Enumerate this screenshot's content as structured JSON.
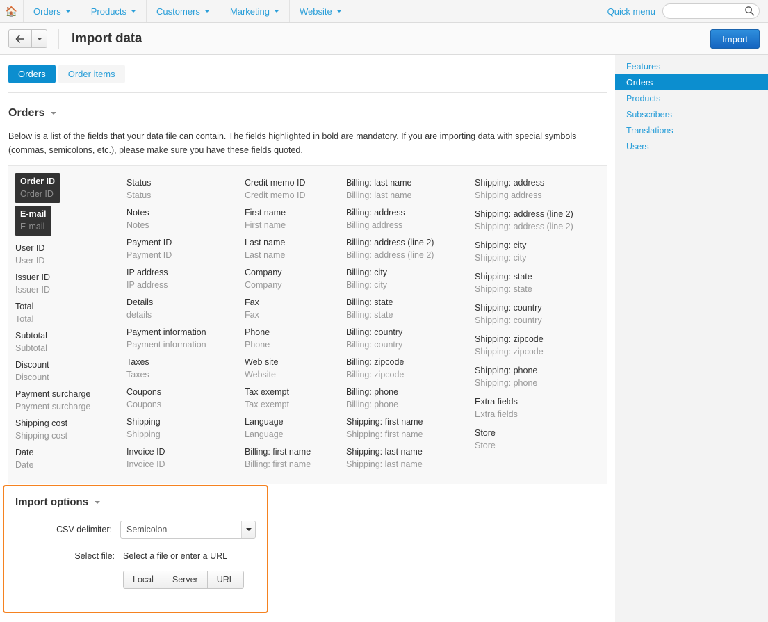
{
  "topnav": {
    "home_icon": "home-icon",
    "items": [
      {
        "label": "Orders",
        "has_caret": true
      },
      {
        "label": "Products",
        "has_caret": true
      },
      {
        "label": "Customers",
        "has_caret": true
      },
      {
        "label": "Marketing",
        "has_caret": true
      },
      {
        "label": "Website",
        "has_caret": true
      }
    ],
    "quick_menu": "Quick menu",
    "search_value": "",
    "search_placeholder": "",
    "search_icon": "search-icon"
  },
  "header": {
    "back_icon": "arrow-left-icon",
    "title": "Import data",
    "import_button": "Import"
  },
  "tabs": [
    {
      "label": "Orders",
      "active": true
    },
    {
      "label": "Order items",
      "active": false
    }
  ],
  "section": {
    "title": "Orders",
    "description": "Below is a list of the fields that your data file can contain. The fields highlighted in bold are mandatory. If you are importing data with special symbols (commas, semicolons, etc.), please make sure you have these fields quoted."
  },
  "fields": {
    "col1": [
      {
        "title": "Order ID",
        "sub": "Order ID",
        "mandatory": true
      },
      {
        "title": "E-mail",
        "sub": "E-mail",
        "mandatory": true
      },
      {
        "title": "User ID",
        "sub": "User ID",
        "mandatory": false
      },
      {
        "title": "Issuer ID",
        "sub": "Issuer ID",
        "mandatory": false
      },
      {
        "title": "Total",
        "sub": "Total",
        "mandatory": false
      },
      {
        "title": "Subtotal",
        "sub": "Subtotal",
        "mandatory": false
      },
      {
        "title": "Discount",
        "sub": "Discount",
        "mandatory": false
      },
      {
        "title": "Payment surcharge",
        "sub": "Payment surcharge",
        "mandatory": false
      },
      {
        "title": "Shipping cost",
        "sub": "Shipping cost",
        "mandatory": false
      },
      {
        "title": "Date",
        "sub": "Date",
        "mandatory": false
      }
    ],
    "col2": [
      {
        "title": "Status",
        "sub": "Status",
        "mandatory": false
      },
      {
        "title": "Notes",
        "sub": "Notes",
        "mandatory": false
      },
      {
        "title": "Payment ID",
        "sub": "Payment ID",
        "mandatory": false
      },
      {
        "title": "IP address",
        "sub": "IP address",
        "mandatory": false
      },
      {
        "title": "Details",
        "sub": "details",
        "mandatory": false
      },
      {
        "title": "Payment information",
        "sub": "Payment information",
        "mandatory": false
      },
      {
        "title": "Taxes",
        "sub": "Taxes",
        "mandatory": false
      },
      {
        "title": "Coupons",
        "sub": "Coupons",
        "mandatory": false
      },
      {
        "title": "Shipping",
        "sub": "Shipping",
        "mandatory": false
      },
      {
        "title": "Invoice ID",
        "sub": "Invoice ID",
        "mandatory": false
      }
    ],
    "col3": [
      {
        "title": "Credit memo ID",
        "sub": "Credit memo ID",
        "mandatory": false
      },
      {
        "title": "First name",
        "sub": "First name",
        "mandatory": false
      },
      {
        "title": "Last name",
        "sub": "Last name",
        "mandatory": false
      },
      {
        "title": "Company",
        "sub": "Company",
        "mandatory": false
      },
      {
        "title": "Fax",
        "sub": "Fax",
        "mandatory": false
      },
      {
        "title": "Phone",
        "sub": "Phone",
        "mandatory": false
      },
      {
        "title": "Web site",
        "sub": "Website",
        "mandatory": false
      },
      {
        "title": "Tax exempt",
        "sub": "Tax exempt",
        "mandatory": false
      },
      {
        "title": "Language",
        "sub": "Language",
        "mandatory": false
      },
      {
        "title": "Billing: first name",
        "sub": "Billing: first name",
        "mandatory": false
      }
    ],
    "col4": [
      {
        "title": "Billing: last name",
        "sub": "Billing: last name",
        "mandatory": false
      },
      {
        "title": "Billing: address",
        "sub": "Billing address",
        "mandatory": false
      },
      {
        "title": "Billing: address (line 2)",
        "sub": "Billing: address (line 2)",
        "mandatory": false
      },
      {
        "title": "Billing: city",
        "sub": "Billing: city",
        "mandatory": false
      },
      {
        "title": "Billing: state",
        "sub": "Billing: state",
        "mandatory": false
      },
      {
        "title": "Billing: country",
        "sub": "Billing: country",
        "mandatory": false
      },
      {
        "title": "Billing: zipcode",
        "sub": "Billing: zipcode",
        "mandatory": false
      },
      {
        "title": "Billing: phone",
        "sub": "Billing: phone",
        "mandatory": false
      },
      {
        "title": "Shipping: first name",
        "sub": "Shipping: first name",
        "mandatory": false
      },
      {
        "title": "Shipping: last name",
        "sub": "Shipping: last name",
        "mandatory": false
      }
    ],
    "col5": [
      {
        "title": "Shipping: address",
        "sub": "Shipping address",
        "mandatory": false
      },
      {
        "title": "Shipping: address (line 2)",
        "sub": "Shipping: address (line 2)",
        "mandatory": false
      },
      {
        "title": "Shipping: city",
        "sub": "Shipping: city",
        "mandatory": false
      },
      {
        "title": "Shipping: state",
        "sub": "Shipping: state",
        "mandatory": false
      },
      {
        "title": "Shipping: country",
        "sub": "Shipping: country",
        "mandatory": false
      },
      {
        "title": "Shipping: zipcode",
        "sub": "Shipping: zipcode",
        "mandatory": false
      },
      {
        "title": "Shipping: phone",
        "sub": "Shipping: phone",
        "mandatory": false
      },
      {
        "title": "Extra fields",
        "sub": "Extra fields",
        "mandatory": false
      },
      {
        "title": "Store",
        "sub": "Store",
        "mandatory": false
      }
    ]
  },
  "import_options": {
    "title": "Import options",
    "csv_delimiter_label": "CSV delimiter:",
    "csv_delimiter_value": "Semicolon",
    "csv_delimiter_options": [
      "Semicolon"
    ],
    "select_file_label": "Select file:",
    "select_file_value": "Select a file or enter a URL",
    "source_buttons": [
      "Local",
      "Server",
      "URL"
    ]
  },
  "sidebar": {
    "items": [
      {
        "label": "Features",
        "active": false
      },
      {
        "label": "Orders",
        "active": true
      },
      {
        "label": "Products",
        "active": false
      },
      {
        "label": "Subscribers",
        "active": false
      },
      {
        "label": "Translations",
        "active": false
      },
      {
        "label": "Users",
        "active": false
      }
    ]
  },
  "colors": {
    "accent_blue": "#0c8ecf",
    "link_blue": "#2b9fd9",
    "import_button": "#1565c0",
    "panel_orange": "#f58220",
    "mandatory_bg": "#333333",
    "fields_bg": "#f8f8f8",
    "sidebar_bg": "#f3f3f3"
  }
}
